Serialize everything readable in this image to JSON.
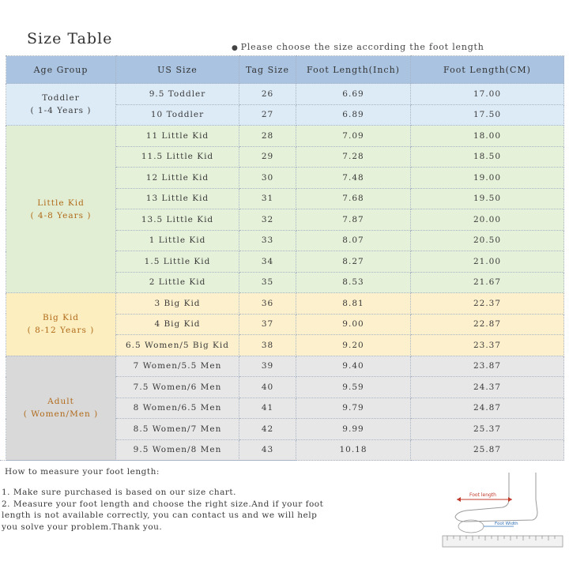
{
  "title": "Size Table",
  "note": "Please choose the size according the foot length",
  "headers": [
    "Age Group",
    "US Size",
    "Tag Size",
    "Foot Length(Inch)",
    "Foot Length(CM)"
  ],
  "groups": [
    {
      "name": "Toddler",
      "range": "( 1-4 Years )",
      "class": "g-toddler",
      "rows": [
        [
          "9.5 Toddler",
          "26",
          "6.69",
          "17.00"
        ],
        [
          "10 Toddler",
          "27",
          "6.89",
          "17.50"
        ]
      ]
    },
    {
      "name": "Little Kid",
      "range": "( 4-8 Years )",
      "class": "g-little",
      "rows": [
        [
          "11 Little Kid",
          "28",
          "7.09",
          "18.00"
        ],
        [
          "11.5 Little Kid",
          "29",
          "7.28",
          "18.50"
        ],
        [
          "12 Little Kid",
          "30",
          "7.48",
          "19.00"
        ],
        [
          "13 Little Kid",
          "31",
          "7.68",
          "19.50"
        ],
        [
          "13.5 Little Kid",
          "32",
          "7.87",
          "20.00"
        ],
        [
          "1 Little Kid",
          "33",
          "8.07",
          "20.50"
        ],
        [
          "1.5 Little Kid",
          "34",
          "8.27",
          "21.00"
        ],
        [
          "2 Little Kid",
          "35",
          "8.53",
          "21.67"
        ]
      ]
    },
    {
      "name": "Big Kid",
      "range": "( 8-12 Years )",
      "class": "g-big",
      "rows": [
        [
          "3 Big Kid",
          "36",
          "8.81",
          "22.37"
        ],
        [
          "4 Big Kid",
          "37",
          "9.00",
          "22.87"
        ],
        [
          "6.5 Women/5 Big Kid",
          "38",
          "9.20",
          "23.37"
        ]
      ]
    },
    {
      "name": "Adult",
      "range": "( Women/Men )",
      "class": "g-adult",
      "rows": [
        [
          "7 Women/5.5 Men",
          "39",
          "9.40",
          "23.87"
        ],
        [
          "7.5 Women/6 Men",
          "40",
          "9.59",
          "24.37"
        ],
        [
          "8 Women/6.5 Men",
          "41",
          "9.79",
          "24.87"
        ],
        [
          "8.5 Women/7 Men",
          "42",
          "9.99",
          "25.37"
        ],
        [
          "9.5 Women/8 Men",
          "43",
          "10.18",
          "25.87"
        ]
      ]
    }
  ],
  "measure": {
    "heading": "How to measure your foot length:",
    "lines": [
      "1. Make sure purchased is based on our size chart.",
      "2. Measure your foot length and choose the right size.And if your foot",
      "   length is not available correctly, you can contact us and we will help",
      "   you solve your problem.Thank you."
    ]
  },
  "illustration": {
    "length_label": "Foot length",
    "width_label": "Foot Width"
  },
  "colors": {
    "header_bg": "#a9c3e0",
    "toddler_bg": "#ddebf7",
    "little_kid_bg": "#e6f1d9",
    "big_kid_bg": "#fdf0cc",
    "adult_bg": "#e7e7e7",
    "group_label_color": "#b06a1a"
  }
}
